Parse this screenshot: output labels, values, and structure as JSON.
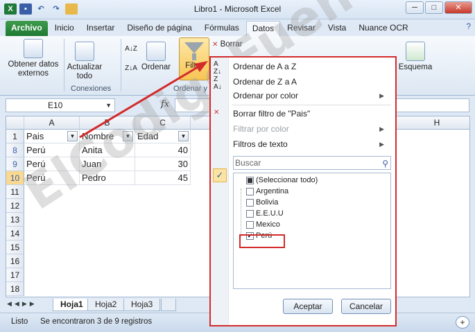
{
  "window": {
    "title": "Libro1  -  Microsoft Excel",
    "controls": [
      "─",
      "□",
      "✕"
    ]
  },
  "menu_tabs": [
    "Archivo",
    "Inicio",
    "Insertar",
    "Diseño de página",
    "Fórmulas",
    "Datos",
    "Revisar",
    "Vista",
    "Nuance OCR"
  ],
  "ribbon": {
    "get_external": "Obtener datos externos",
    "refresh_all": "Actualizar todo",
    "connections_label": "Conexiones",
    "sort_btn": "Ordenar",
    "filter_btn": "Filtro",
    "clear_btn": "Borrar",
    "sort_filter_label": "Ordenar y",
    "outline_btn": "Esquema"
  },
  "formula_bar": {
    "name_box": "E10",
    "fx": "fx",
    "value": ""
  },
  "columns": [
    "A",
    "B",
    "C",
    "H"
  ],
  "rows": [
    {
      "num": "1",
      "a": "Pais",
      "b": "Nombre",
      "c": "Edad"
    },
    {
      "num": "8",
      "a": "Perú",
      "b": "Anita",
      "c": "40"
    },
    {
      "num": "9",
      "a": "Perú",
      "b": "Juan",
      "c": "30"
    },
    {
      "num": "10",
      "a": "Perú",
      "b": "Pedro",
      "c": "45"
    },
    {
      "num": "11"
    },
    {
      "num": "12"
    },
    {
      "num": "13"
    },
    {
      "num": "14"
    },
    {
      "num": "15"
    },
    {
      "num": "16"
    },
    {
      "num": "17"
    },
    {
      "num": "18"
    }
  ],
  "sheets": [
    "Hoja1",
    "Hoja2",
    "Hoja3"
  ],
  "status": {
    "mode": "Listo",
    "message": "Se encontraron 3 de 9 registros"
  },
  "watermark": "ElCodigoFuente.com",
  "filter_menu": {
    "sort_az": "Ordenar de A a Z",
    "sort_za": "Ordenar de Z a A",
    "sort_color": "Ordenar por color",
    "clear_filter": "Borrar filtro de \"Pais\"",
    "filter_color": "Filtrar por color",
    "text_filters": "Filtros de texto",
    "search_placeholder": "Buscar",
    "items": [
      {
        "label": "(Seleccionar todo)",
        "state": "partial"
      },
      {
        "label": "Argentina",
        "state": "unchecked"
      },
      {
        "label": "Bolivia",
        "state": "unchecked"
      },
      {
        "label": "E.E.U.U",
        "state": "unchecked"
      },
      {
        "label": "Mexico",
        "state": "unchecked"
      },
      {
        "label": "Perú",
        "state": "checked"
      }
    ],
    "ok": "Aceptar",
    "cancel": "Cancelar"
  },
  "colors": {
    "highlight_red": "#d32a2a",
    "file_tab": "#1f7a33",
    "selected_row": "#f9d98f"
  }
}
